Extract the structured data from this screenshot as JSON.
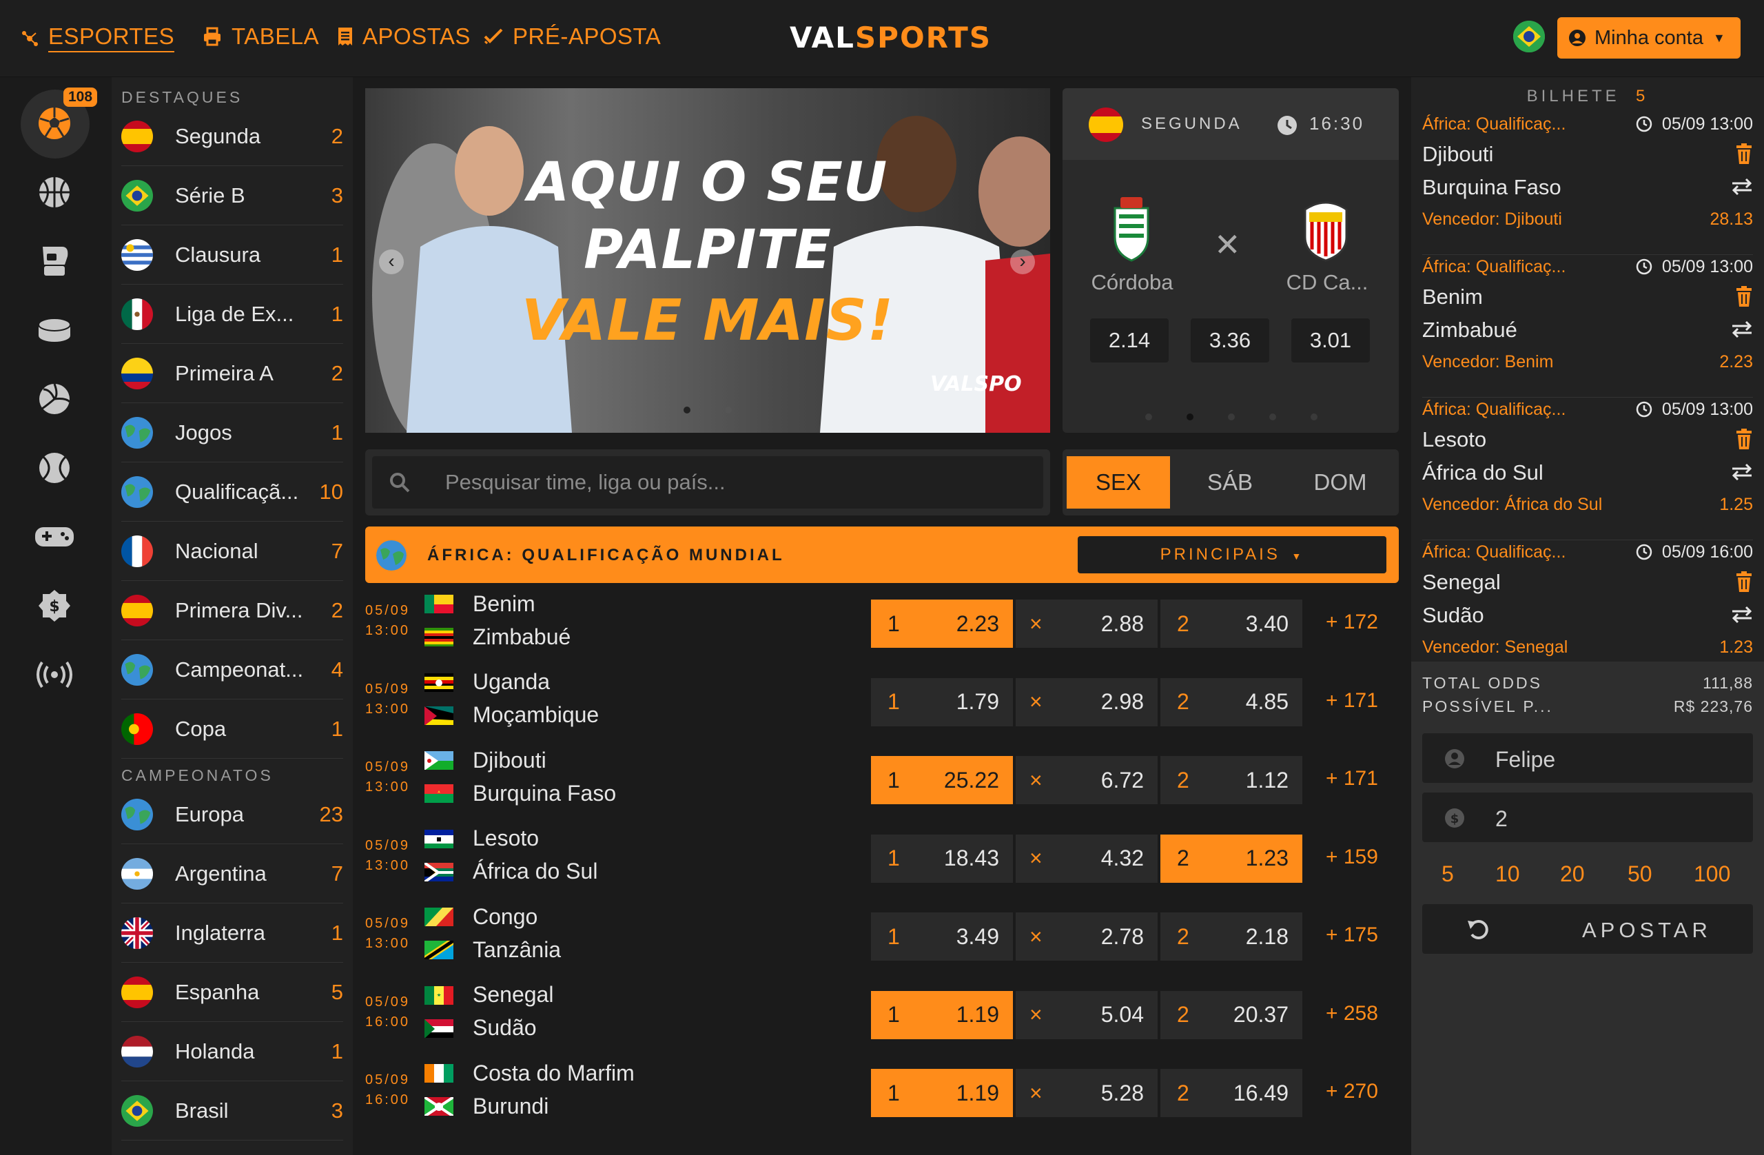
{
  "nav": {
    "items": [
      {
        "label": "ESPORTES",
        "icon": "esports-icon"
      },
      {
        "label": "TABELA",
        "icon": "print-icon"
      },
      {
        "label": "APOSTAS",
        "icon": "receipt-icon"
      },
      {
        "label": "PRÉ-APOSTA",
        "icon": "check-icon"
      }
    ],
    "logo_left": "VAL",
    "logo_right": "SPORTS",
    "account_label": "Minha conta"
  },
  "rail": {
    "badge": "108",
    "icons": [
      "soccer-icon",
      "basketball-icon",
      "boxing-icon",
      "hockey-puck-icon",
      "volleyball-icon",
      "tennis-icon",
      "gamepad-icon",
      "money-icon",
      "live-signal-icon"
    ]
  },
  "leagues": {
    "highlights_title": "DESTAQUES",
    "highlights": [
      {
        "name": "Segunda",
        "count": "2",
        "flag": "es"
      },
      {
        "name": "Série B",
        "count": "3",
        "flag": "br"
      },
      {
        "name": "Clausura",
        "count": "1",
        "flag": "uy"
      },
      {
        "name": "Liga de Ex...",
        "count": "1",
        "flag": "mx"
      },
      {
        "name": "Primeira A",
        "count": "2",
        "flag": "co"
      },
      {
        "name": "Jogos",
        "count": "1",
        "flag": "world"
      },
      {
        "name": "Qualificaçã...",
        "count": "10",
        "flag": "world"
      },
      {
        "name": "Nacional",
        "count": "7",
        "flag": "fr"
      },
      {
        "name": "Primera Div...",
        "count": "2",
        "flag": "es"
      },
      {
        "name": "Campeonat...",
        "count": "4",
        "flag": "world"
      },
      {
        "name": "Copa",
        "count": "1",
        "flag": "pt"
      }
    ],
    "championships_title": "CAMPEONATOS",
    "championships": [
      {
        "name": "Europa",
        "count": "23",
        "flag": "world"
      },
      {
        "name": "Argentina",
        "count": "7",
        "flag": "ar"
      },
      {
        "name": "Inglaterra",
        "count": "1",
        "flag": "gb"
      },
      {
        "name": "Espanha",
        "count": "5",
        "flag": "es"
      },
      {
        "name": "Holanda",
        "count": "1",
        "flag": "nl"
      },
      {
        "name": "Brasil",
        "count": "3",
        "flag": "br"
      }
    ]
  },
  "banner": {
    "line1": "AQUI O SEU",
    "line2": "PALPITE",
    "line3": "VALE MAIS!",
    "watermark": "VALSPO"
  },
  "match_card": {
    "league": "SEGUNDA",
    "time": "16:30",
    "home": "Córdoba",
    "away": "CD Ca...",
    "odds": [
      "2.14",
      "3.36",
      "3.01"
    ]
  },
  "search": {
    "placeholder": "Pesquisar time, liga ou país..."
  },
  "days": [
    "SEX",
    "SÁB",
    "DOM"
  ],
  "league_header": {
    "title": "ÁFRICA: QUALIFICAÇÃO MUNDIAL",
    "market": "PRINCIPAIS"
  },
  "matches": [
    {
      "date": "05/09",
      "time": "13:00",
      "home": "Benim",
      "away": "Zimbabué",
      "o1": "2.23",
      "ox": "2.88",
      "o2": "3.40",
      "more": "+ 172",
      "sel": "1"
    },
    {
      "date": "05/09",
      "time": "13:00",
      "home": "Uganda",
      "away": "Moçambique",
      "o1": "1.79",
      "ox": "2.98",
      "o2": "4.85",
      "more": "+ 171",
      "sel": ""
    },
    {
      "date": "05/09",
      "time": "13:00",
      "home": "Djibouti",
      "away": "Burquina Faso",
      "o1": "25.22",
      "ox": "6.72",
      "o2": "1.12",
      "more": "+ 171",
      "sel": "1"
    },
    {
      "date": "05/09",
      "time": "13:00",
      "home": "Lesoto",
      "away": "África do Sul",
      "o1": "18.43",
      "ox": "4.32",
      "o2": "1.23",
      "more": "+ 159",
      "sel": "2"
    },
    {
      "date": "05/09",
      "time": "13:00",
      "home": "Congo",
      "away": "Tanzânia",
      "o1": "3.49",
      "ox": "2.78",
      "o2": "2.18",
      "more": "+ 175",
      "sel": ""
    },
    {
      "date": "05/09",
      "time": "16:00",
      "home": "Senegal",
      "away": "Sudão",
      "o1": "1.19",
      "ox": "5.04",
      "o2": "20.37",
      "more": "+ 258",
      "sel": "1"
    },
    {
      "date": "05/09",
      "time": "16:00",
      "home": "Costa do Marfim",
      "away": "Burundi",
      "o1": "1.19",
      "ox": "5.28",
      "o2": "16.49",
      "more": "+ 270",
      "sel": "1"
    }
  ],
  "labels": {
    "one": "1",
    "two": "2",
    "x": "×"
  },
  "slip": {
    "title": "BILHETE",
    "count": "5",
    "bets": [
      {
        "league": "África: Qualificaç...",
        "datetime": "05/09 13:00",
        "home": "Djibouti",
        "away": "Burquina Faso",
        "pick": "Vencedor: Djibouti",
        "odd": "28.13"
      },
      {
        "league": "África: Qualificaç...",
        "datetime": "05/09 13:00",
        "home": "Benim",
        "away": "Zimbabué",
        "pick": "Vencedor: Benim",
        "odd": "2.23"
      },
      {
        "league": "África: Qualificaç...",
        "datetime": "05/09 13:00",
        "home": "Lesoto",
        "away": "África do Sul",
        "pick": "Vencedor: África do Sul",
        "odd": "1.25"
      },
      {
        "league": "África: Qualificaç...",
        "datetime": "05/09 16:00",
        "home": "Senegal",
        "away": "Sudão",
        "pick": "Vencedor: Senegal",
        "odd": "1.23"
      }
    ],
    "total_odds_label": "TOTAL ODDS",
    "total_odds": "111,88",
    "possible_label": "POSSÍVEL P...",
    "possible_value": "R$ 223,76",
    "name_value": "Felipe",
    "amount_value": "2",
    "quick_amounts": [
      "5",
      "10",
      "20",
      "50",
      "100"
    ],
    "submit_label": "APOSTAR"
  },
  "colors": {
    "accent": "#ff8c1a",
    "bg": "#1b1b1b",
    "panel": "#2a2a2a"
  }
}
